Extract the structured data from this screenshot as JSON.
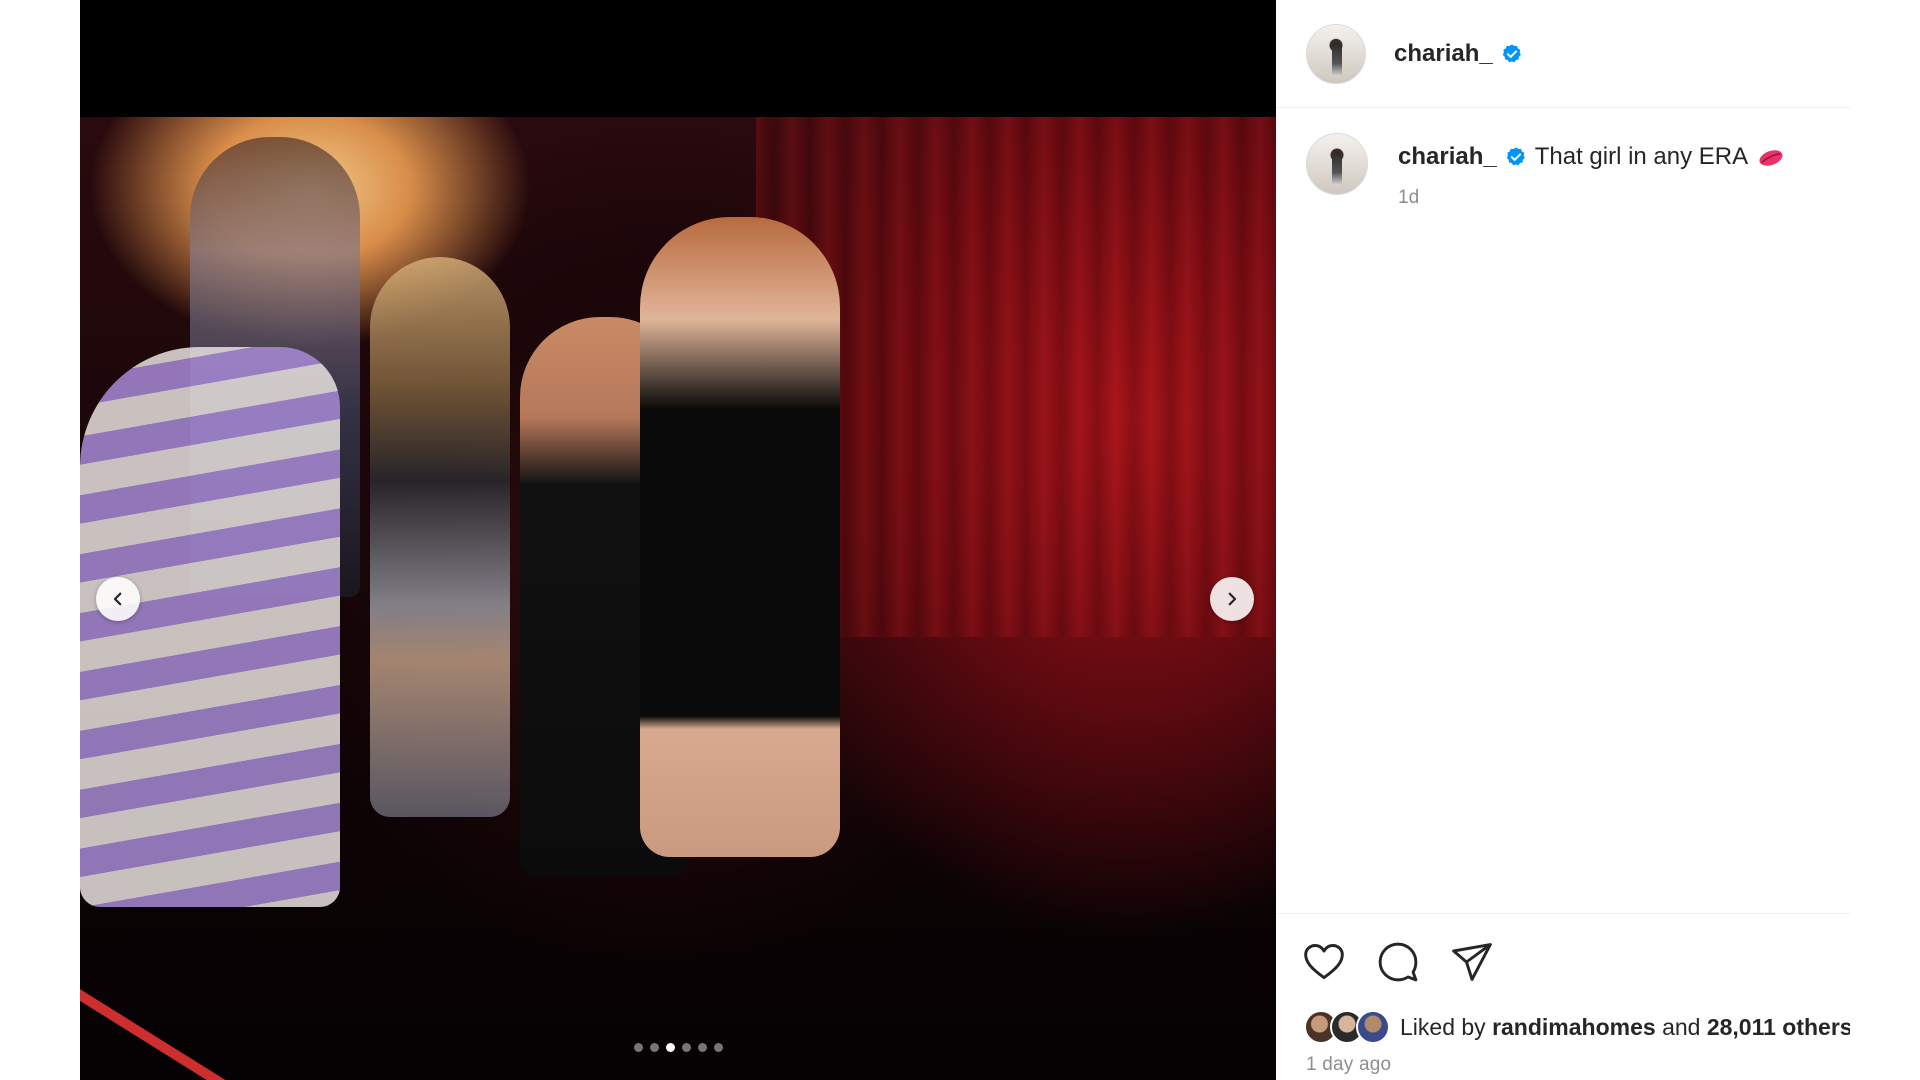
{
  "post": {
    "username": "chariah_",
    "verified": true,
    "caption_text": "That girl in any ERA",
    "caption_emoji": "kiss-mark-icon",
    "caption_time": "1d",
    "liked_by_prefix": "Liked by",
    "liked_by_user": "randimahomes",
    "liked_by_conjunction": "and",
    "liked_by_others": "28,011 others",
    "posted_ago": "1 day ago"
  },
  "carousel": {
    "total_slides": 6,
    "active_slide": 3,
    "prev_icon": "chevron-left-icon",
    "next_icon": "chevron-right-icon"
  },
  "actions": {
    "like_icon": "heart-icon",
    "comment_icon": "comment-icon",
    "share_icon": "send-icon"
  },
  "colors": {
    "verified_blue": "#0095f6",
    "text_primary": "#262626",
    "text_secondary": "#8e8e8e",
    "lips_pink": "#e8336a"
  }
}
